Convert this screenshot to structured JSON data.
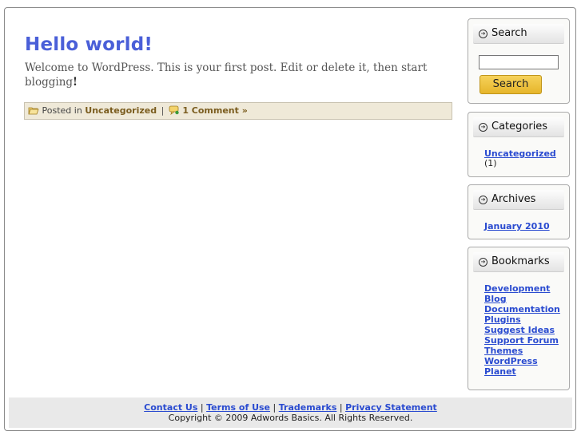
{
  "post": {
    "title": "Hello world!",
    "body": "Welcome to WordPress. This is your first post. Edit or delete it, then start blogging",
    "body_end": "!",
    "meta_prefix": "Posted in",
    "category": "Uncategorized",
    "separator": "|",
    "comments": "1 Comment »"
  },
  "sidebar": {
    "search": {
      "title": "Search",
      "button": "Search",
      "value": ""
    },
    "categories": {
      "title": "Categories",
      "items": [
        {
          "label": "Uncategorized",
          "count": "(1)"
        }
      ]
    },
    "archives": {
      "title": "Archives",
      "items": [
        {
          "label": "January 2010"
        }
      ]
    },
    "bookmarks": {
      "title": "Bookmarks",
      "items": [
        {
          "label": "Development Blog"
        },
        {
          "label": "Documentation"
        },
        {
          "label": "Plugins"
        },
        {
          "label": "Suggest Ideas"
        },
        {
          "label": "Support Forum"
        },
        {
          "label": "Themes"
        },
        {
          "label": "WordPress Planet"
        }
      ]
    }
  },
  "footer": {
    "links": [
      "Contact Us",
      "Terms of Use",
      "Trademarks",
      "Privacy Statement"
    ],
    "separator": "|",
    "copyright": "Copyright © 2009 Adwords Basics. All Rights Reserved."
  },
  "colors": {
    "title": "#4a5fd8",
    "link": "#2a4bd0",
    "meta_bg": "#efe9d8",
    "button": "#e6b52b"
  },
  "icons": {
    "meta_category": "folder-icon",
    "meta_comments": "comment-icon",
    "widget_heading": "arrow-circle-icon"
  }
}
